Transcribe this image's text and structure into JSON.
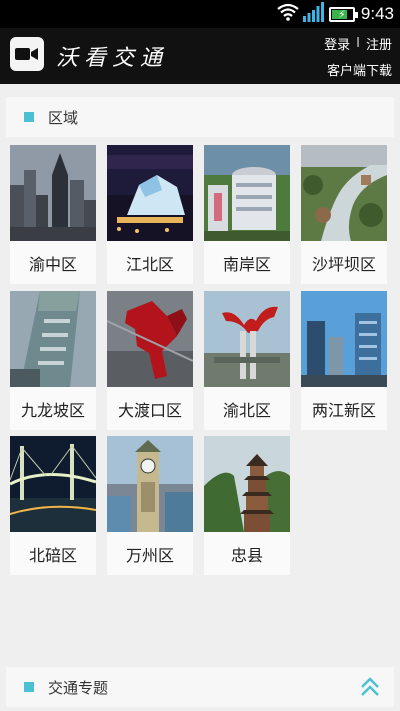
{
  "status_bar": {
    "time": "9:43",
    "icons": [
      "wifi-icon",
      "signal-icon",
      "battery-charging-icon"
    ]
  },
  "header": {
    "app_icon": "video-camera-icon",
    "title": "沃看交通",
    "login_label": "登录",
    "separator": "I",
    "register_label": "注册",
    "download_label": "客户端下载"
  },
  "region_section": {
    "title": "区域",
    "items": [
      {
        "label": "渝中区",
        "photo": "skyline"
      },
      {
        "label": "江北区",
        "photo": "theater-night"
      },
      {
        "label": "南岸区",
        "photo": "round-building"
      },
      {
        "label": "沙坪坝区",
        "photo": "riverside-green"
      },
      {
        "label": "九龙坡区",
        "photo": "tower-closeup"
      },
      {
        "label": "大渡口区",
        "photo": "red-sculpture"
      },
      {
        "label": "渝北区",
        "photo": "red-monument"
      },
      {
        "label": "两江新区",
        "photo": "glass-towers"
      },
      {
        "label": "北碚区",
        "photo": "bridge-night"
      },
      {
        "label": "万州区",
        "photo": "clock-tower"
      },
      {
        "label": "忠县",
        "photo": "pagoda"
      }
    ]
  },
  "traffic_section": {
    "title": "交通专题",
    "icon": "double-chevron-up-icon"
  },
  "colors": {
    "accent": "#4cbfd3",
    "header_bg": "#111111",
    "page_bg": "#efefef"
  }
}
